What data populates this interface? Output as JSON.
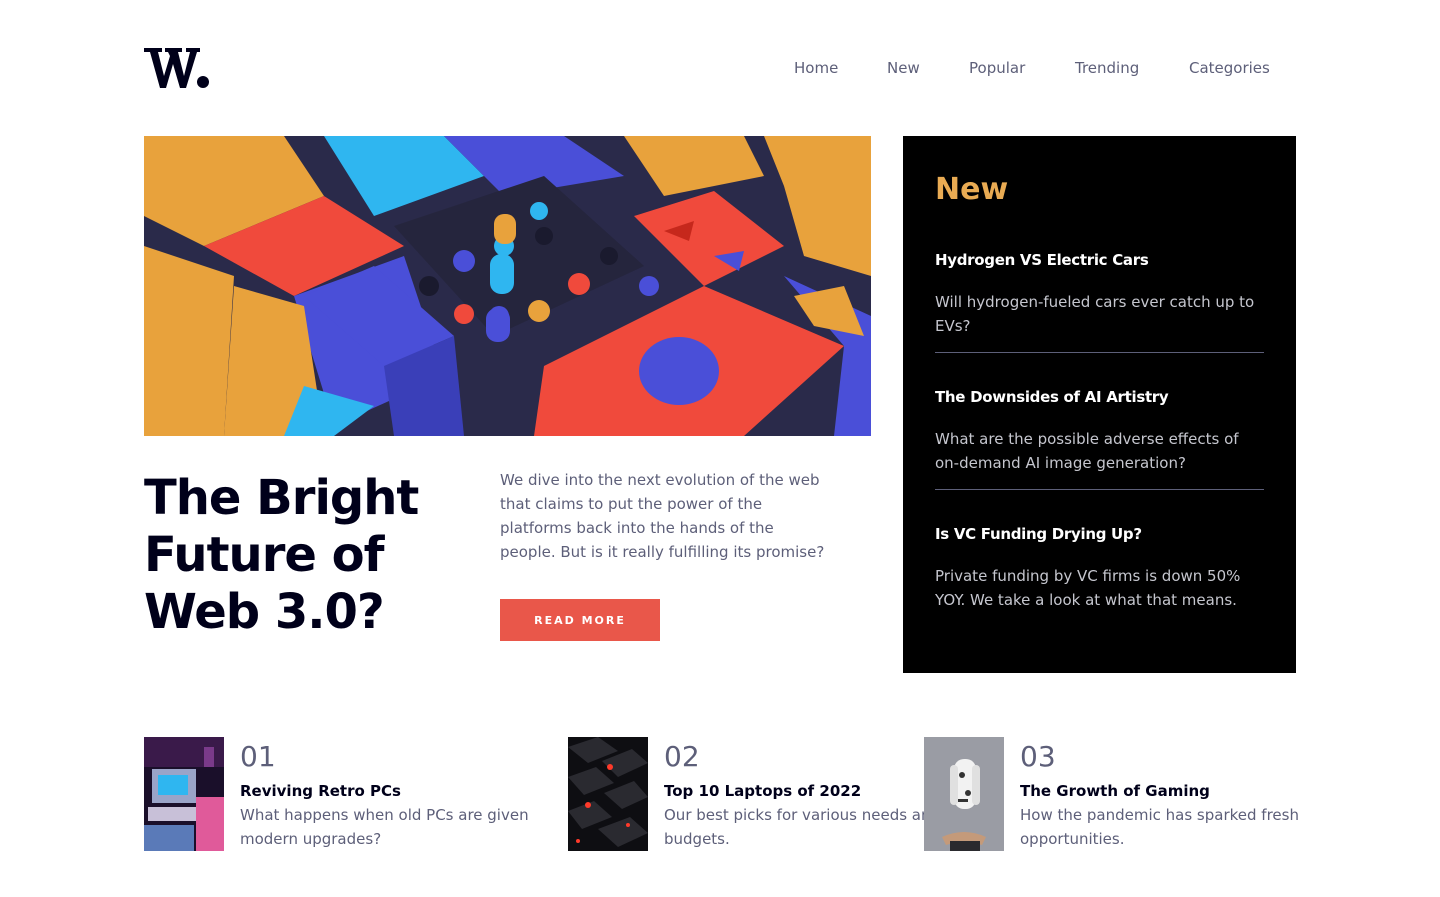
{
  "nav": {
    "logo_alt": "W.",
    "items": [
      "Home",
      "New",
      "Popular",
      "Trending",
      "Categories"
    ]
  },
  "hero": {
    "image_icon": "abstract-blocks-image",
    "title": "The Bright Future of Web 3.0?",
    "description": "We dive into the next evolution of the web that claims to put the power of the platforms back into the hands of the people. But is it really fulfilling its promise?",
    "button_label": "READ MORE"
  },
  "new_section": {
    "heading": "New",
    "items": [
      {
        "title": "Hydrogen VS Electric Cars",
        "description": "Will hydrogen-fueled cars ever catch up to EVs?"
      },
      {
        "title": "The Downsides of AI Artistry",
        "description": "What are the possible adverse effects of on-demand AI image generation?"
      },
      {
        "title": "Is VC Funding Drying Up?",
        "description": "Private funding by VC firms is down 50% YOY. We take a look at what that means."
      }
    ]
  },
  "articles": [
    {
      "number": "01",
      "title": "Reviving Retro PCs",
      "description": "What happens when old PCs are given modern upgrades?",
      "image_icon": "retro-pc-image"
    },
    {
      "number": "02",
      "title": "Top 10 Laptops of 2022",
      "description": "Our best picks for various needs and budgets.",
      "image_icon": "laptop-keyboard-image"
    },
    {
      "number": "03",
      "title": "The Growth of Gaming",
      "description": "How the pandemic has sparked fresh opportunities.",
      "image_icon": "game-controller-image"
    }
  ],
  "colors": {
    "accent_red": "#e9574a",
    "accent_orange": "#e9ab53",
    "dark": "#00001a",
    "grey": "#5d5f79"
  }
}
